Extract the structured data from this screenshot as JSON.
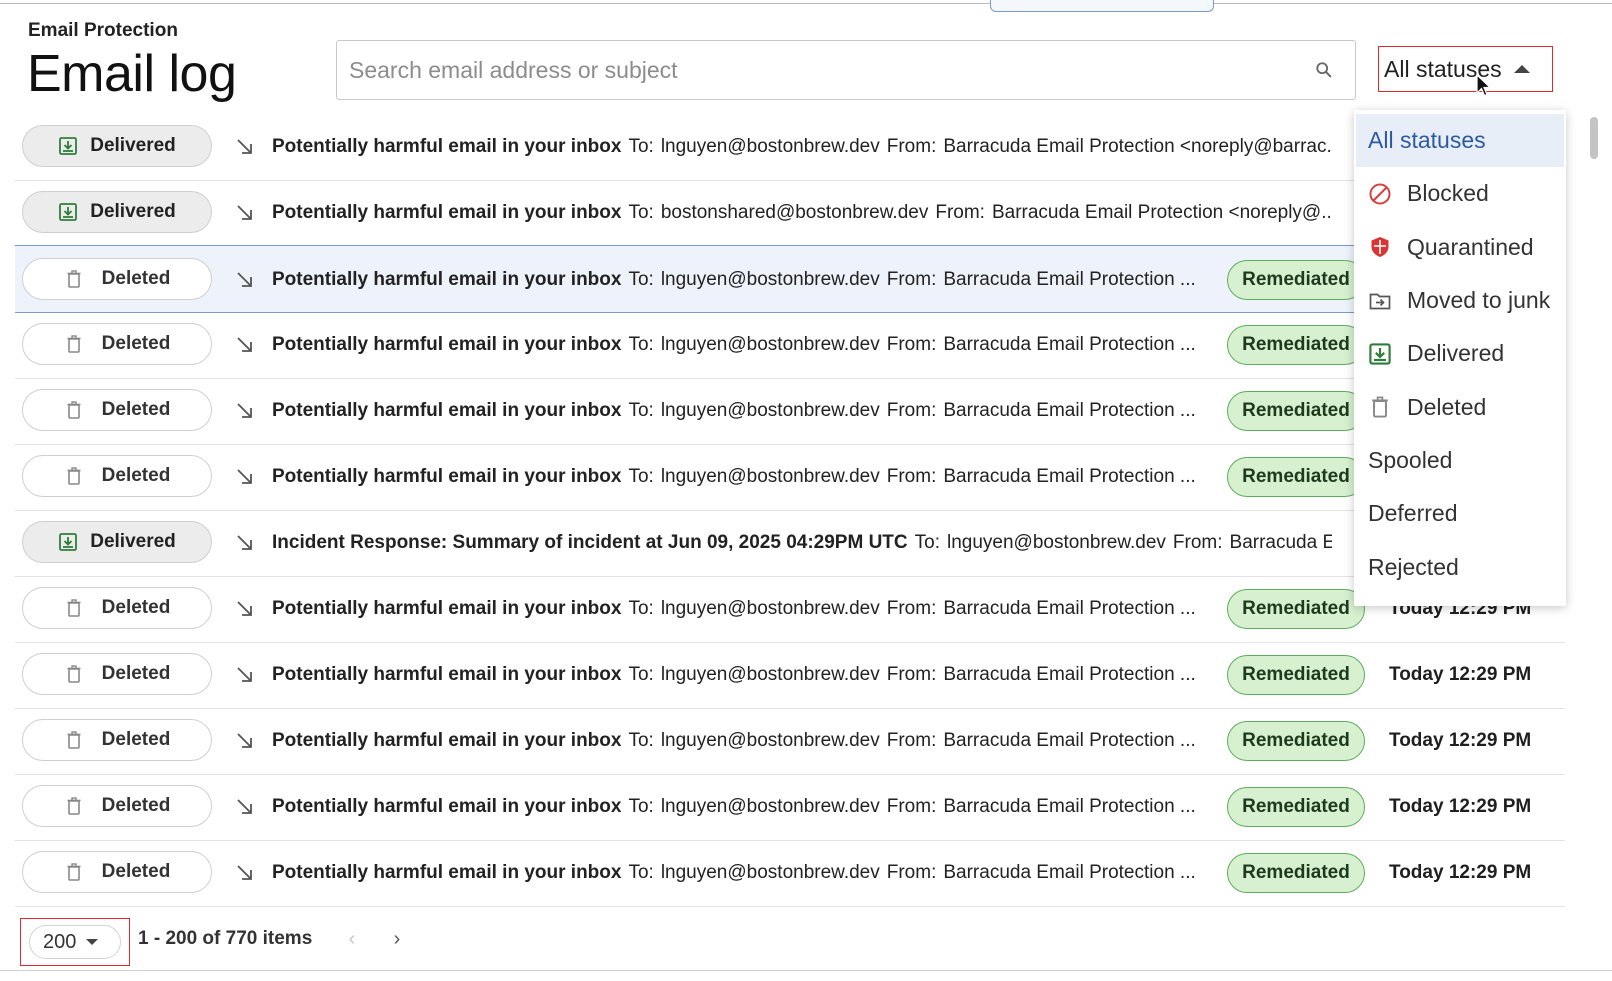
{
  "header": {
    "eyebrow": "Email Protection",
    "title": "Email log"
  },
  "search": {
    "placeholder": "Search email address or subject",
    "value": ""
  },
  "status_filter": {
    "selected": "All statuses",
    "options": [
      "All statuses",
      "Blocked",
      "Quarantined",
      "Moved to junk",
      "Delivered",
      "Deleted",
      "Spooled",
      "Deferred",
      "Rejected"
    ],
    "icons": [
      "",
      "blocked-icon",
      "shield-icon",
      "junk-folder-icon",
      "delivered-icon",
      "trash-icon",
      "",
      "",
      ""
    ]
  },
  "labels": {
    "to": "To:",
    "from": "From:"
  },
  "rows": [
    {
      "status": "Delivered",
      "subject": "Potentially harmful email in your inbox",
      "to": "lnguyen@bostonbrew.dev",
      "from": "Barracuda Email Protection <noreply@barrac...",
      "badge": "",
      "time": ""
    },
    {
      "status": "Delivered",
      "subject": "Potentially harmful email in your inbox",
      "to": "bostonshared@bostonbrew.dev",
      "from": "Barracuda Email Protection <noreply@...",
      "badge": "",
      "time": ""
    },
    {
      "status": "Deleted",
      "subject": "Potentially harmful email in your inbox",
      "to": "lnguyen@bostonbrew.dev",
      "from": "Barracuda Email Protection ...",
      "badge": "Remediated",
      "time": "",
      "selected": true
    },
    {
      "status": "Deleted",
      "subject": "Potentially harmful email in your inbox",
      "to": "lnguyen@bostonbrew.dev",
      "from": "Barracuda Email Protection ...",
      "badge": "Remediated",
      "time": ""
    },
    {
      "status": "Deleted",
      "subject": "Potentially harmful email in your inbox",
      "to": "lnguyen@bostonbrew.dev",
      "from": "Barracuda Email Protection ...",
      "badge": "Remediated",
      "time": ""
    },
    {
      "status": "Deleted",
      "subject": "Potentially harmful email in your inbox",
      "to": "lnguyen@bostonbrew.dev",
      "from": "Barracuda Email Protection ...",
      "badge": "Remediated",
      "time": ""
    },
    {
      "status": "Delivered",
      "subject": "Incident Response: Summary of incident at Jun 09, 2025 04:29PM UTC",
      "to": "lnguyen@bostonbrew.dev",
      "from": "Barracuda E...",
      "badge": "",
      "time": ""
    },
    {
      "status": "Deleted",
      "subject": "Potentially harmful email in your inbox",
      "to": "lnguyen@bostonbrew.dev",
      "from": "Barracuda Email Protection ...",
      "badge": "Remediated",
      "time": "Today 12:29 PM"
    },
    {
      "status": "Deleted",
      "subject": "Potentially harmful email in your inbox",
      "to": "lnguyen@bostonbrew.dev",
      "from": "Barracuda Email Protection ...",
      "badge": "Remediated",
      "time": "Today 12:29 PM"
    },
    {
      "status": "Deleted",
      "subject": "Potentially harmful email in your inbox",
      "to": "lnguyen@bostonbrew.dev",
      "from": "Barracuda Email Protection ...",
      "badge": "Remediated",
      "time": "Today 12:29 PM"
    },
    {
      "status": "Deleted",
      "subject": "Potentially harmful email in your inbox",
      "to": "lnguyen@bostonbrew.dev",
      "from": "Barracuda Email Protection ...",
      "badge": "Remediated",
      "time": "Today 12:29 PM"
    },
    {
      "status": "Deleted",
      "subject": "Potentially harmful email in your inbox",
      "to": "lnguyen@bostonbrew.dev",
      "from": "Barracuda Email Protection ...",
      "badge": "Remediated",
      "time": "Today 12:29 PM"
    }
  ],
  "pagination": {
    "page_size": "200",
    "range": "1 - 200 of 770 items",
    "prev": "‹",
    "next": "›"
  },
  "colors": {
    "accent_blue": "#2c5aa0",
    "remediated_bg": "#d6f0d0",
    "remediated_border": "#5cae5c",
    "highlight_red": "#d92d2d"
  }
}
